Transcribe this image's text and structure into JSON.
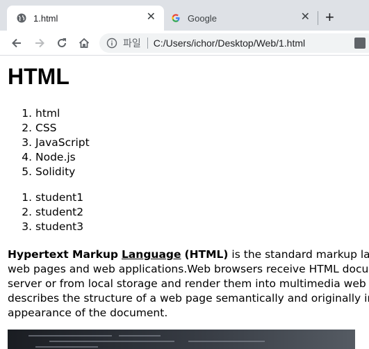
{
  "tabs": [
    {
      "title": "1.html",
      "icon": "globe-icon",
      "active": true
    },
    {
      "title": "Google",
      "icon": "google-icon",
      "active": false
    }
  ],
  "toolbar": {
    "file_label": "파일",
    "url": "C:/Users/ichor/Desktop/Web/1.html"
  },
  "page": {
    "heading": "HTML",
    "list1": [
      "html",
      "CSS",
      "JavaScript",
      "Node.js",
      "Solidity"
    ],
    "list2": [
      "student1",
      "student2",
      "student3"
    ],
    "para": {
      "bold1": "Hypertext Markup",
      "link": "Language",
      "bold2": "(HTML)",
      "line1_rest": " is the standard markup language for creating",
      "line2": "web pages and web applications.Web browsers receive HTML documents from a web",
      "line3": "server or from local storage and render them into multimedia web pages. HTML",
      "line4": "describes the structure of a web page semantically and originally included cues for the",
      "line5": "appearance of the document."
    }
  }
}
